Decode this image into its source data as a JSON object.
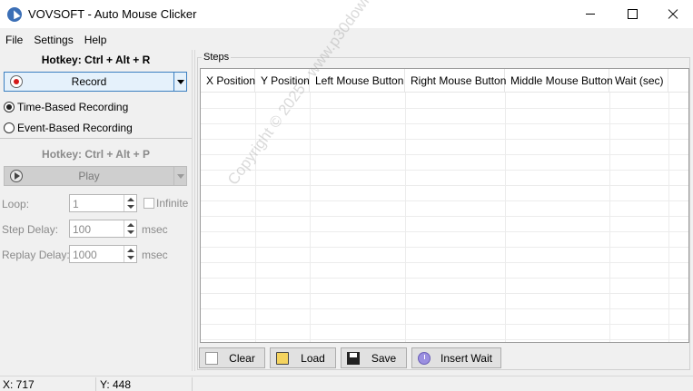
{
  "window": {
    "title": "VOVSOFT - Auto Mouse Clicker"
  },
  "menu": [
    "File",
    "Settings",
    "Help"
  ],
  "record": {
    "hotkey": "Hotkey: Ctrl + Alt + R",
    "button_label": "Record",
    "modes": [
      {
        "label": "Time-Based Recording",
        "checked": true
      },
      {
        "label": "Event-Based Recording",
        "checked": false
      }
    ]
  },
  "play": {
    "hotkey": "Hotkey: Ctrl + Alt + P",
    "button_label": "Play",
    "loop": {
      "label": "Loop:",
      "value": "1",
      "infinite_label": "Infinite"
    },
    "step_delay": {
      "label": "Step Delay:",
      "value": "100",
      "unit": "msec"
    },
    "replay_delay": {
      "label": "Replay Delay:",
      "value": "1000",
      "unit": "msec"
    }
  },
  "steps": {
    "label": "Steps",
    "columns": [
      "X Position",
      "Y Position",
      "Left Mouse Button",
      "Right Mouse Button",
      "Middle Mouse Button",
      "Wait (sec)"
    ],
    "watermark": "Copyright © 2025 - www.p30download.com"
  },
  "toolbar": {
    "clear": "Clear",
    "load": "Load",
    "save": "Save",
    "insert_wait": "Insert Wait"
  },
  "status": {
    "x": "X: 717",
    "y": "Y: 448"
  },
  "icons": {
    "app": "mouse-cursor-icon",
    "record": "record-dot-icon",
    "play": "play-icon",
    "clear": "blank-page-icon",
    "load": "folder-open-icon",
    "save": "floppy-disk-icon",
    "insert_wait": "clock-icon"
  }
}
